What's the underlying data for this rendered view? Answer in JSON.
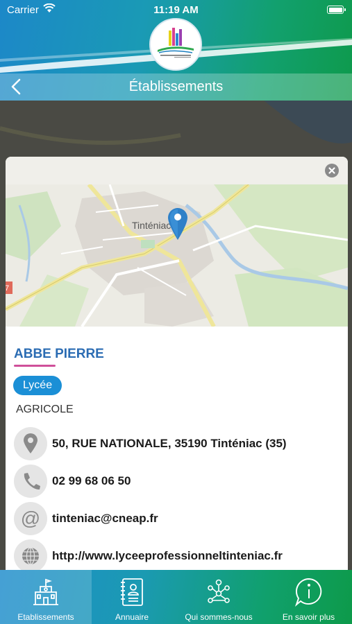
{
  "status_bar": {
    "carrier": "Carrier",
    "time": "11:19 AM"
  },
  "nav": {
    "title": "Établissements"
  },
  "establishment": {
    "name": "ABBE PIERRE",
    "type_badge": "Lycée",
    "category": "AGRICOLE",
    "address": "50, RUE NATIONALE, 35190 Tinténiac (35)",
    "phone": "02 99 68 06 50",
    "email": "tinteniac@cneap.fr",
    "website": "http://www.lyceeprofessionneltinteniac.fr"
  },
  "map": {
    "town_label": "Tinténiac",
    "road_number": "7"
  },
  "tabs": [
    {
      "label": "Etablissements",
      "icon": "school-building-icon",
      "active": true
    },
    {
      "label": "Annuaire",
      "icon": "directory-book-icon",
      "active": false
    },
    {
      "label": "Qui sommes-nous",
      "icon": "people-network-icon",
      "active": false
    },
    {
      "label": "En savoir plus",
      "icon": "info-bubble-icon",
      "active": false
    }
  ],
  "colors": {
    "brand_blue": "#1c88c8",
    "brand_green": "#0e9a4c",
    "name_blue": "#2b6cb3",
    "badge_blue": "#1b8fd6",
    "underline_pink": "#cf4f9a"
  }
}
